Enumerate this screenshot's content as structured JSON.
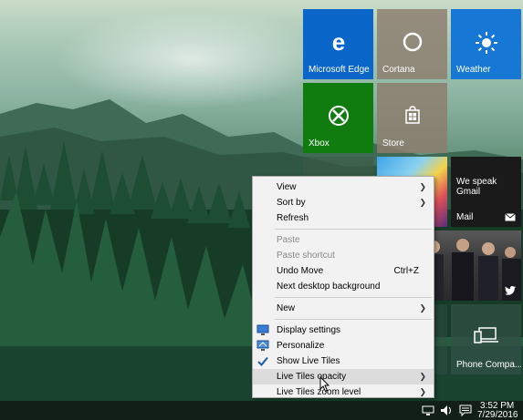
{
  "tiles": {
    "edge": {
      "label": "Microsoft Edge",
      "color": "#0a66c8"
    },
    "cortana": {
      "label": "Cortana"
    },
    "weather": {
      "label": "Weather",
      "color": "#1777d4"
    },
    "xbox": {
      "label": "Xbox",
      "color": "#107c10"
    },
    "store": {
      "label": "Store"
    },
    "mail": {
      "label": "Mail",
      "headline": "We speak Gmail"
    },
    "phone": {
      "label": "Phone Compa..."
    }
  },
  "context_menu": {
    "view": "View",
    "sort_by": "Sort by",
    "refresh": "Refresh",
    "paste": "Paste",
    "paste_shortcut": "Paste shortcut",
    "undo_move": "Undo Move",
    "undo_shortcut": "Ctrl+Z",
    "next_background": "Next desktop background",
    "new": "New",
    "display_settings": "Display settings",
    "personalize": "Personalize",
    "show_live_tiles": "Show Live Tiles",
    "live_tiles_opacity": "Live Tiles opacity",
    "live_tiles_zoom": "Live Tiles zoom level"
  },
  "taskbar": {
    "time": "3:52 PM",
    "date": "7/29/2016"
  },
  "icons": {
    "edge": "edge-icon",
    "cortana": "cortana-ring-icon",
    "weather": "sun-icon",
    "xbox": "xbox-icon",
    "store": "shopping-bag-icon",
    "mail": "envelope-icon",
    "twitter": "twitter-bird-icon",
    "phone": "phone-laptop-icon"
  }
}
